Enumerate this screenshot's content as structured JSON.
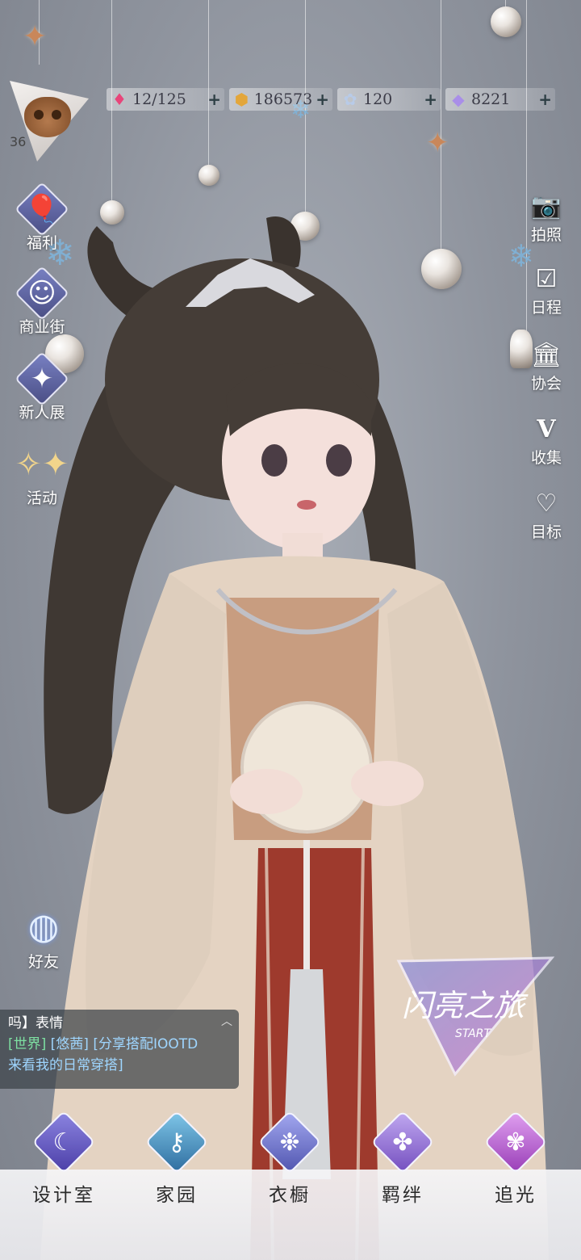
{
  "player": {
    "level": "36"
  },
  "currencies": [
    {
      "icon": "heart-gem-icon",
      "value": "12/125",
      "color": "#e8457a"
    },
    {
      "icon": "gold-coin-icon",
      "value": "186573",
      "color": "#e3a63b"
    },
    {
      "icon": "crystal-flower-icon",
      "value": "120",
      "color": "#b8cbe8"
    },
    {
      "icon": "diamond-icon",
      "value": "8221",
      "color": "#a98ee8"
    }
  ],
  "left_menu": [
    {
      "key": "welfare",
      "label": "福利",
      "icon": "hot-air-balloon-icon"
    },
    {
      "key": "mall",
      "label": "商业街",
      "icon": "shopping-bag-icon"
    },
    {
      "key": "newbie",
      "label": "新人展",
      "icon": "crystal-fan-icon"
    },
    {
      "key": "events",
      "label": "活动",
      "icon": "stars-icon"
    }
  ],
  "right_menu": [
    {
      "key": "photo",
      "label": "拍照",
      "icon": "camera-icon"
    },
    {
      "key": "schedule",
      "label": "日程",
      "icon": "calendar-check-icon"
    },
    {
      "key": "guild",
      "label": "协会",
      "icon": "building-icon"
    },
    {
      "key": "collection",
      "label": "收集",
      "icon": "v-badge-icon"
    },
    {
      "key": "goals",
      "label": "目标",
      "icon": "heart-target-icon"
    }
  ],
  "friends": {
    "label": "好友"
  },
  "chat": {
    "line1": "吗】表情",
    "channel": "[世界]",
    "user": "[悠茜]",
    "message": "[分享搭配IOOTD",
    "line3": "来看我的日常穿搭]"
  },
  "start_badge": {
    "title": "闪亮之旅",
    "subtitle": "START"
  },
  "bottom_nav": [
    {
      "key": "design",
      "label": "设计室",
      "icon": "moon-pen-icon",
      "color": "#5a4fb8"
    },
    {
      "key": "home",
      "label": "家园",
      "icon": "key-icon",
      "color": "#3f86b8"
    },
    {
      "key": "wardrobe",
      "label": "衣橱",
      "icon": "snow-crystal-icon",
      "color": "#6a70c8"
    },
    {
      "key": "bond",
      "label": "羁绊",
      "icon": "clover-icon",
      "color": "#8f6ad0"
    },
    {
      "key": "chase",
      "label": "追光",
      "icon": "butterfly-icon",
      "color": "#b455c8"
    }
  ]
}
